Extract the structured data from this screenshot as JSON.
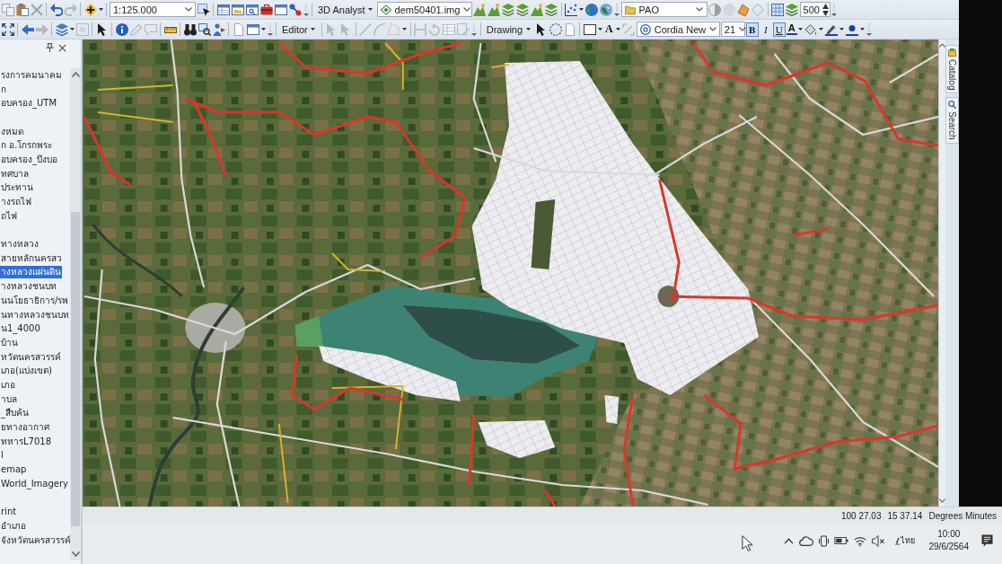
{
  "toolbar_standard": {
    "scale": "1:125.000",
    "analyst_menu": "3D Analyst",
    "surface_layer": "dem50401.img",
    "layer_dropdown": "PAO",
    "spin_value": "500"
  },
  "toolbar_tools": {
    "editor_menu": "Editor",
    "drawing_menu": "Drawing",
    "text_tool": "A",
    "font": "Cordia New",
    "font_size": "21",
    "styles": [
      {
        "label": "B",
        "kind": "bold",
        "on": true
      },
      {
        "label": "I",
        "kind": "italic",
        "on": false
      },
      {
        "label": "U",
        "kind": "underline",
        "on": true
      }
    ],
    "font_color": "A"
  },
  "table_of_contents": {
    "groups": [
      {
        "layers": [
          {
            "name": "รงการคมนาคม",
            "selected": false
          },
          {
            "name": "ก",
            "selected": false
          },
          {
            "name": "อบครอง_UTM",
            "selected": false
          }
        ]
      },
      {
        "layers": [
          {
            "name": "งหมด",
            "selected": false
          },
          {
            "name": "ก อ.โกรกพระ",
            "selected": false
          },
          {
            "name": "อบครอง_บึงบอ",
            "selected": false
          },
          {
            "name": "ทศบาล",
            "selected": false
          },
          {
            "name": "ประทาน",
            "selected": false
          },
          {
            "name": "างรถไฟ",
            "selected": false
          },
          {
            "name": "ถไฟ",
            "selected": false
          }
        ]
      },
      {
        "layers": [
          {
            "name": "ทางหลวง",
            "selected": false
          },
          {
            "name": "สายหลักนครสว",
            "selected": false
          },
          {
            "name": "างหลวงแผ่นดิน",
            "selected": true
          },
          {
            "name": "างหลวงชนบท",
            "selected": false
          },
          {
            "name": "นนโยธาธิการ/รพ",
            "selected": false
          },
          {
            "name": "นทางหลวงชนบท",
            "selected": false
          },
          {
            "name": "น1_4000",
            "selected": false
          },
          {
            "name": "บ้าน",
            "selected": false
          },
          {
            "name": "หวัดนครสวรรค์",
            "selected": false
          },
          {
            "name": "เภอ(แบ่งเขต)",
            "selected": false
          },
          {
            "name": "เภอ",
            "selected": false
          },
          {
            "name": "าบล",
            "selected": false
          },
          {
            "name": "_สืบค้น",
            "selected": false
          },
          {
            "name": "ยทางอากาศ",
            "selected": false
          },
          {
            "name": "ทหารL7018",
            "selected": false
          },
          {
            "name": "l",
            "selected": false
          },
          {
            "name": "emap",
            "selected": false
          },
          {
            "name": "World_Imagery",
            "selected": false
          }
        ]
      },
      {
        "layers": [
          {
            "name": "rint",
            "selected": false
          },
          {
            "name": "อำเภอ",
            "selected": false
          },
          {
            "name": "จังหวัดนครสวรรค์",
            "selected": false
          }
        ]
      }
    ]
  },
  "dock_tabs": [
    {
      "label": "Catalog",
      "kind": "catalog"
    },
    {
      "label": "Search",
      "kind": "search"
    }
  ],
  "status_bar": {
    "x_coordinate": "100 27.03",
    "y_coordinate": "15 37.14",
    "units": "Degrees Minutes"
  },
  "taskbar": {
    "language": "ไทย",
    "time": "10:00",
    "date": "29/6/2564"
  }
}
